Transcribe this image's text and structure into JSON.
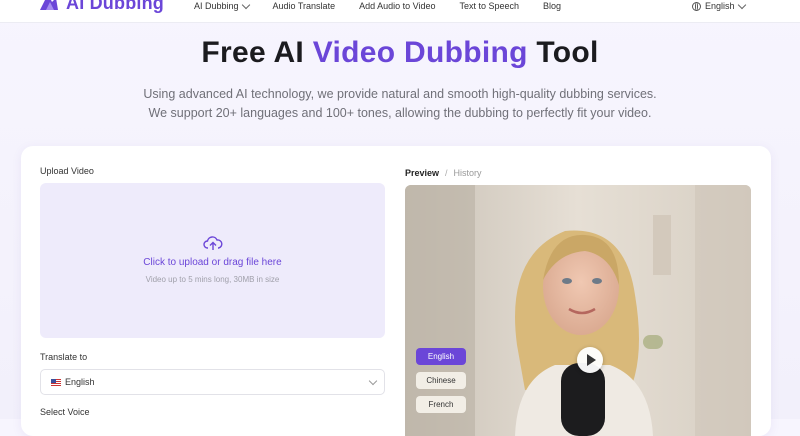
{
  "brand": {
    "name": "AI Dubbing",
    "color": "#6b46d8"
  },
  "nav": {
    "items": [
      {
        "label": "AI Dubbing",
        "has_dropdown": true
      },
      {
        "label": "Audio Translate"
      },
      {
        "label": "Add Audio to Video"
      },
      {
        "label": "Text to Speech"
      },
      {
        "label": "Blog"
      }
    ],
    "language": "English"
  },
  "hero": {
    "title_prefix": "Free AI",
    "title_accent": "Video Dubbing",
    "title_suffix": "Tool",
    "subtitle_line1": "Using advanced AI technology, we provide natural and smooth high-quality dubbing services.",
    "subtitle_line2": "We support 20+ languages and 100+ tones, allowing the dubbing to perfectly fit your video."
  },
  "upload": {
    "label": "Upload Video",
    "cta": "Click to upload or drag file here",
    "hint": "Video up to 5 mins long, 30MB in size"
  },
  "translate": {
    "label": "Translate to",
    "selected": "English",
    "flag_icon": "us-flag-icon"
  },
  "voice": {
    "label": "Select Voice"
  },
  "preview": {
    "tabs": [
      {
        "label": "Preview",
        "active": true
      },
      {
        "label": "History"
      }
    ],
    "separator": "/",
    "languages": [
      {
        "label": "English",
        "active": true
      },
      {
        "label": "Chinese"
      },
      {
        "label": "French"
      }
    ]
  }
}
